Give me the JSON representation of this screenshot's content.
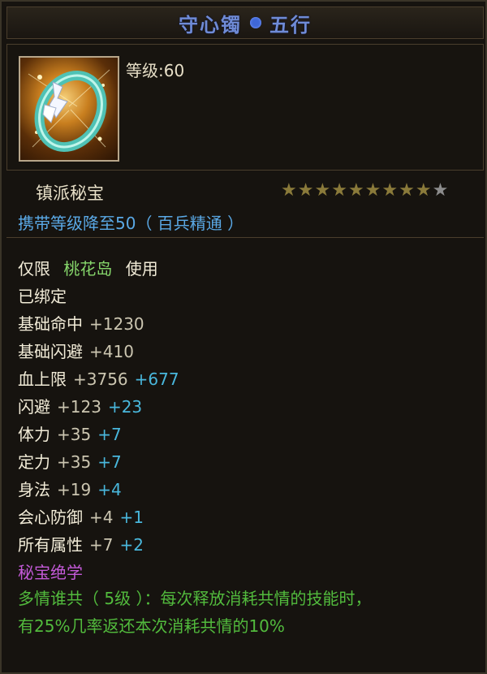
{
  "title": {
    "name": "守心镯",
    "attribute": "五行"
  },
  "item": {
    "level_label": "等级:60",
    "type_label": "镇派秘宝",
    "stars": {
      "filled": 9,
      "total": 10
    },
    "carry_text": "携带等级降至50（ 百兵精通 ）"
  },
  "usage": {
    "prefix": "仅限",
    "faction": "桃花岛",
    "suffix": "使用"
  },
  "bound": "已绑定",
  "stats": [
    {
      "name": "基础命中",
      "base": "+1230",
      "bonus": ""
    },
    {
      "name": "基础闪避",
      "base": "+410",
      "bonus": ""
    },
    {
      "name": "血上限",
      "base": "+3756",
      "bonus": "+677"
    },
    {
      "name": "闪避",
      "base": "+123",
      "bonus": "+23"
    },
    {
      "name": "体力",
      "base": "+35",
      "bonus": "+7"
    },
    {
      "name": "定力",
      "base": "+35",
      "bonus": "+7"
    },
    {
      "name": "身法",
      "base": "+19",
      "bonus": "+4"
    },
    {
      "name": "会心防御",
      "base": "+4",
      "bonus": "+1"
    },
    {
      "name": "所有属性",
      "base": "+7",
      "bonus": "+2"
    }
  ],
  "skill": {
    "header": "秘宝绝学",
    "line1": "多情谁共（ 5级 ）：每次释放消耗共情的技能时，",
    "line2": "有25%几率返还本次消耗共情的10%"
  },
  "colors": {
    "title": "#6f8bd6",
    "green": "#86d76b",
    "cyan": "#49b7dc",
    "purple": "#c45ad8",
    "skill_green": "#52bb3d"
  }
}
